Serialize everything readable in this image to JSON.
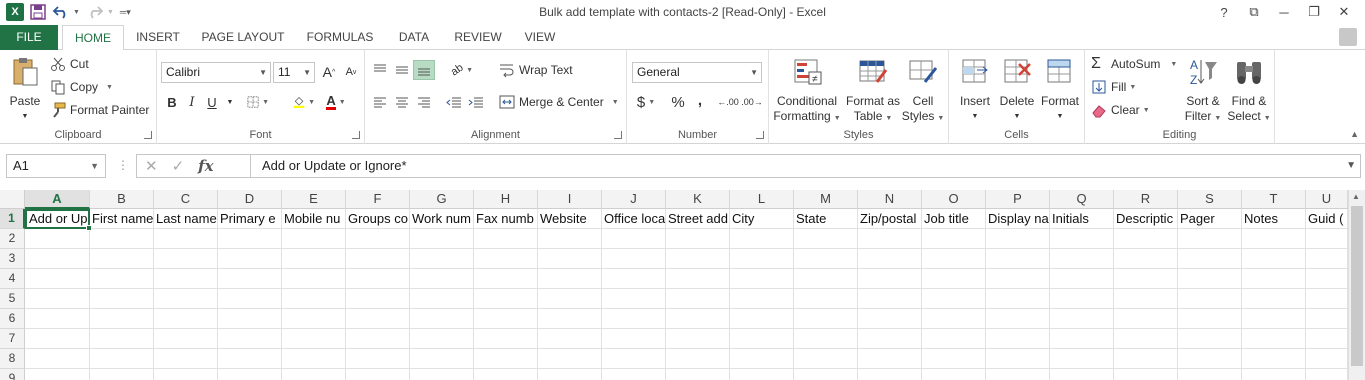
{
  "window": {
    "title": "Bulk add template with contacts-2  [Read-Only] - Excel",
    "help": "?",
    "restore_ribbon": "⧉",
    "minimize": "─",
    "maximize": "❐",
    "close": "✕"
  },
  "qat": {
    "app_logo": "X",
    "save_icon": "save-icon",
    "undo_icon": "undo-icon",
    "redo_icon": "redo-icon",
    "customize_icon": "customize-icon"
  },
  "tabs": [
    {
      "label": "FILE"
    },
    {
      "label": "HOME"
    },
    {
      "label": "INSERT"
    },
    {
      "label": "PAGE LAYOUT"
    },
    {
      "label": "FORMULAS"
    },
    {
      "label": "DATA"
    },
    {
      "label": "REVIEW"
    },
    {
      "label": "VIEW"
    }
  ],
  "ribbon": {
    "clipboard": {
      "paste": "Paste",
      "cut": "Cut",
      "copy": "Copy",
      "format_painter": "Format Painter",
      "label": "Clipboard"
    },
    "font": {
      "name": "Calibri",
      "size": "11",
      "grow": "A",
      "shrink": "A",
      "bold": "B",
      "italic": "I",
      "underline": "U",
      "label": "Font"
    },
    "alignment": {
      "wrap_text": "Wrap Text",
      "merge_center": "Merge & Center",
      "label": "Alignment"
    },
    "number": {
      "format": "General",
      "currency": "$",
      "percent": "%",
      "comma": ",",
      "inc_dec": ".00",
      "label": "Number"
    },
    "styles": {
      "conditional_1": "Conditional",
      "conditional_2": "Formatting",
      "format_table_1": "Format as",
      "format_table_2": "Table",
      "cell_styles_1": "Cell",
      "cell_styles_2": "Styles",
      "label": "Styles"
    },
    "cells": {
      "insert": "Insert",
      "delete": "Delete",
      "format": "Format",
      "label": "Cells"
    },
    "editing": {
      "autosum": "AutoSum",
      "fill": "Fill",
      "clear": "Clear",
      "sort_1": "Sort &",
      "sort_2": "Filter",
      "find_1": "Find &",
      "find_2": "Select",
      "label": "Editing"
    }
  },
  "formula_bar": {
    "name_box": "A1",
    "formula": "Add or Update or Ignore*",
    "fx": "fx",
    "cancel": "✕",
    "enter": "✓"
  },
  "grid": {
    "columns": [
      "A",
      "B",
      "C",
      "D",
      "E",
      "F",
      "G",
      "H",
      "I",
      "J",
      "K",
      "L",
      "M",
      "N",
      "O",
      "P",
      "Q",
      "R",
      "S",
      "T",
      "U"
    ],
    "rows": [
      "1",
      "2",
      "3",
      "4",
      "5",
      "6",
      "7",
      "8",
      "9"
    ],
    "row1": [
      "Add or Up",
      "First name",
      "Last name",
      "Primary e",
      "Mobile nu",
      "Groups co",
      "Work num",
      "Fax numb",
      "Website",
      "Office loca",
      "Street add",
      "City",
      "State",
      "Zip/postal",
      "Job title",
      "Display na",
      "Initials",
      "Descriptic",
      "Pager",
      "Notes",
      "Guid ("
    ]
  }
}
